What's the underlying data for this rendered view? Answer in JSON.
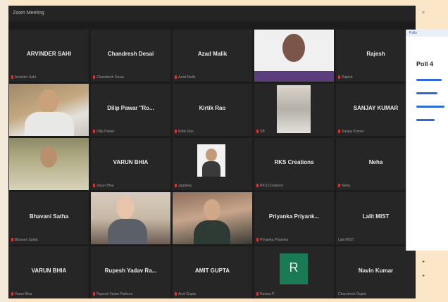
{
  "window": {
    "title": "Zoom Meeting"
  },
  "participants": [
    {
      "name": "ARVINDER SAHI",
      "label": "Arvinder Sahi",
      "muted": true,
      "type": "name"
    },
    {
      "name": "Chandresh Desai",
      "label": "Chandresh Desai",
      "muted": true,
      "type": "name"
    },
    {
      "name": "Azad Malik",
      "label": "Azad Malik",
      "muted": true,
      "type": "name"
    },
    {
      "name": "",
      "label": "",
      "muted": false,
      "type": "video-purple"
    },
    {
      "name": "Rajesh",
      "label": "Rajesh",
      "muted": true,
      "type": "name"
    },
    {
      "name": "",
      "label": "",
      "muted": false,
      "type": "video-man1"
    },
    {
      "name": "Dilip Pawar \"Ro...",
      "label": "Dilip Pawar",
      "muted": true,
      "type": "name"
    },
    {
      "name": "Kirtik Rao",
      "label": "Kirtik Rao",
      "muted": true,
      "type": "name"
    },
    {
      "name": "",
      "label": "SB",
      "muted": true,
      "type": "video-group"
    },
    {
      "name": "SANJAY KUMAR",
      "label": "Sanjay Kumar",
      "muted": true,
      "type": "name"
    },
    {
      "name": "",
      "label": "",
      "muted": false,
      "type": "video-man2"
    },
    {
      "name": "VARUN BHIA",
      "label": "Varun Bhia",
      "muted": true,
      "type": "name"
    },
    {
      "name": "",
      "label": "Jagdeep",
      "muted": true,
      "type": "video-center"
    },
    {
      "name": "RKS Creations",
      "label": "RKS Creations",
      "muted": true,
      "type": "name"
    },
    {
      "name": "Neha",
      "label": "Neha",
      "muted": true,
      "type": "name"
    },
    {
      "name": "Bhavani Satha",
      "label": "Bhavani Satha",
      "muted": true,
      "type": "name"
    },
    {
      "name": "",
      "label": "",
      "muted": false,
      "type": "video-woman1"
    },
    {
      "name": "",
      "label": "",
      "muted": false,
      "type": "video-woman2"
    },
    {
      "name": "Priyanka Priyank...",
      "label": "Priyanka Priyanka",
      "muted": true,
      "type": "name"
    },
    {
      "name": "Lalit MIST",
      "label": "Lalit MIST",
      "muted": false,
      "type": "name"
    },
    {
      "name": "VARUN BHIA",
      "label": "Varun Bhia",
      "muted": true,
      "type": "name"
    },
    {
      "name": "Rupesh Yadav Ra...",
      "label": "Rupesh Yadav Rathore",
      "muted": true,
      "type": "name"
    },
    {
      "name": "AMIT GUPTA",
      "label": "Amit Gupta",
      "muted": true,
      "type": "name"
    },
    {
      "name": "",
      "label": "Ravina P.",
      "muted": true,
      "type": "avatar",
      "initial": "R",
      "avatar_color": "#1a7a55"
    },
    {
      "name": "Navin Kumar",
      "label": "Chandresh Gupta",
      "muted": false,
      "type": "name"
    }
  ],
  "sidepanel": {
    "header": "Polls",
    "title": "Poll 4"
  }
}
